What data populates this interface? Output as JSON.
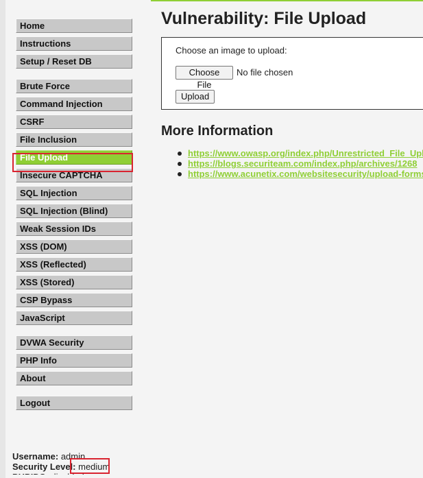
{
  "sidebar": {
    "groups": [
      {
        "items": [
          {
            "label": "Home"
          },
          {
            "label": "Instructions"
          },
          {
            "label": "Setup / Reset DB"
          }
        ]
      },
      {
        "items": [
          {
            "label": "Brute Force"
          },
          {
            "label": "Command Injection"
          },
          {
            "label": "CSRF"
          },
          {
            "label": "File Inclusion"
          },
          {
            "label": "File Upload",
            "active": true
          },
          {
            "label": "Insecure CAPTCHA"
          },
          {
            "label": "SQL Injection"
          },
          {
            "label": "SQL Injection (Blind)"
          },
          {
            "label": "Weak Session IDs"
          },
          {
            "label": "XSS (DOM)"
          },
          {
            "label": "XSS (Reflected)"
          },
          {
            "label": "XSS (Stored)"
          },
          {
            "label": "CSP Bypass"
          },
          {
            "label": "JavaScript"
          }
        ]
      },
      {
        "items": [
          {
            "label": "DVWA Security"
          },
          {
            "label": "PHP Info"
          },
          {
            "label": "About"
          }
        ]
      },
      {
        "items": [
          {
            "label": "Logout"
          }
        ]
      }
    ]
  },
  "main": {
    "title": "Vulnerability: File Upload",
    "upload": {
      "prompt": "Choose an image to upload:",
      "choose_label": "Choose File",
      "file_status": "No file chosen",
      "upload_label": "Upload"
    },
    "more_info": {
      "title": "More Information",
      "links": [
        {
          "text": "https://www.owasp.org/index.php/Unrestricted_File_Upload"
        },
        {
          "text": "https://blogs.securiteam.com/index.php/archives/1268"
        },
        {
          "text": "https://www.acunetix.com/websitesecurity/upload-forms-threat/"
        }
      ]
    }
  },
  "user_info": {
    "username_label": "Username:",
    "username_value": "admin",
    "security_label": "Security Level:",
    "security_value": "medium",
    "phpids_label": "PHPIDS:",
    "phpids_value": "disabled"
  },
  "colors": {
    "accent": "#8fcf35",
    "highlight": "#d9232f",
    "menu_background": "#c8c8c8",
    "page_background": "#f4f4f4"
  }
}
